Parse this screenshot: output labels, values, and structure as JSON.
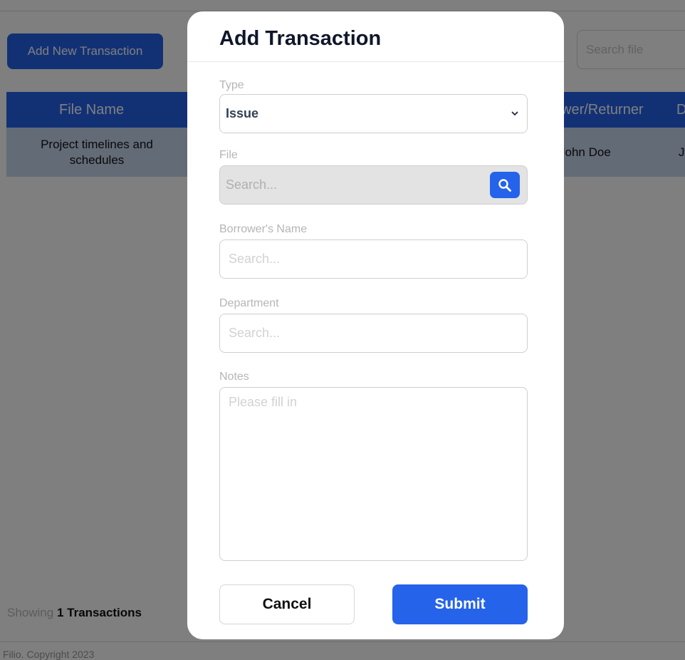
{
  "page": {
    "add_button_label": "Add New Transaction",
    "search_file_placeholder": "Search file",
    "table": {
      "columns": [
        "File Name",
        "wer/Returner",
        "D"
      ],
      "rows": [
        {
          "file_name": "Project timelines and schedules",
          "borrower": "John Doe",
          "date": "J"
        }
      ]
    },
    "showing_label": "Showing",
    "showing_count": "1 Transactions",
    "footer_text": "Filio. Copyright 2023"
  },
  "modal": {
    "title": "Add Transaction",
    "type_label": "Type",
    "type_value": "Issue",
    "file_label": "File",
    "file_placeholder": "Search...",
    "borrower_label": "Borrower's Name",
    "borrower_placeholder": "Search...",
    "department_label": "Department",
    "department_placeholder": "Search...",
    "notes_label": "Notes",
    "notes_placeholder": "Please fill in",
    "cancel_label": "Cancel",
    "submit_label": "Submit"
  },
  "icons": {
    "type_chevron": "chevron-down-icon",
    "file_search": "search-icon"
  },
  "colors": {
    "accent": "#2563eb",
    "overlay": "rgba(0,0,0,0.5)",
    "table_row": "#c6d6ef"
  }
}
